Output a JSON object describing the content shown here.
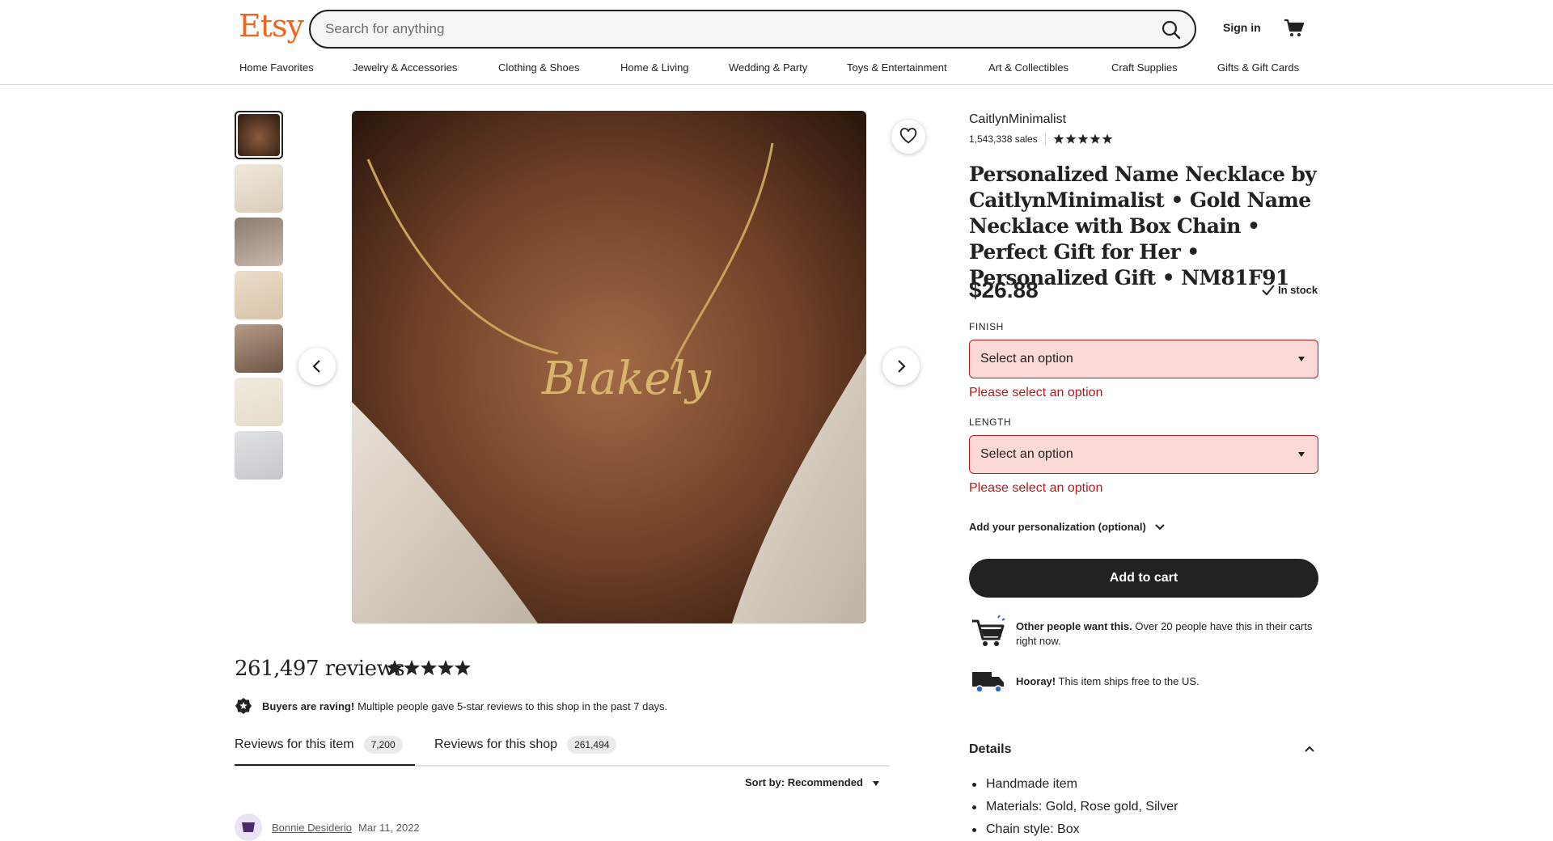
{
  "header": {
    "logo": "Etsy",
    "search_placeholder": "Search for anything",
    "sign_in": "Sign in",
    "nav": [
      "Home Favorites",
      "Jewelry & Accessories",
      "Clothing & Shoes",
      "Home & Living",
      "Wedding & Party",
      "Toys & Entertainment",
      "Art & Collectibles",
      "Craft Supplies",
      "Gifts & Gift Cards"
    ]
  },
  "gallery": {
    "thumbnail_count": 7,
    "main_image_text": "Blakely"
  },
  "reviews": {
    "title": "261,497 reviews",
    "rating_stars": 5,
    "raving_bold": "Buyers are raving!",
    "raving_text": "Multiple people gave 5-star reviews to this shop in the past 7 days.",
    "tabs": [
      {
        "label": "Reviews for this item",
        "count": "7,200"
      },
      {
        "label": "Reviews for this shop",
        "count": "261,494"
      }
    ],
    "sort_label": "Sort by: Recommended",
    "first_review": {
      "name": "Bonnie Desiderio",
      "date": "Mar 11, 2022"
    }
  },
  "listing": {
    "shop_name": "CaitlynMinimalist",
    "sales": "1,543,338 sales",
    "shop_rating_stars": 5,
    "title": "Personalized Name Necklace by CaitlynMinimalist • Gold Name Necklace with Box Chain • Perfect Gift for Her • Personalized Gift • NM81F91",
    "price": "$26.88",
    "stock": "In stock",
    "options": [
      {
        "label": "FINISH",
        "value": "Select an option",
        "error": "Please select an option"
      },
      {
        "label": "LENGTH",
        "value": "Select an option",
        "error": "Please select an option"
      }
    ],
    "personalization": "Add your personalization (optional)",
    "add_to_cart": "Add to cart",
    "demand_bold": "Other people want this.",
    "demand_text": "Over 20 people have this in their carts right now.",
    "shipping_bold": "Hooray!",
    "shipping_text": "This item ships free to the US.",
    "details_label": "Details",
    "details": [
      "Handmade item",
      "Materials: Gold, Rose gold, Silver",
      "Chain style: Box"
    ]
  },
  "colors": {
    "brand": "#f1641e",
    "error": "#b31b1b",
    "error_bg": "#fbd9d7",
    "primary_button": "#222222"
  }
}
